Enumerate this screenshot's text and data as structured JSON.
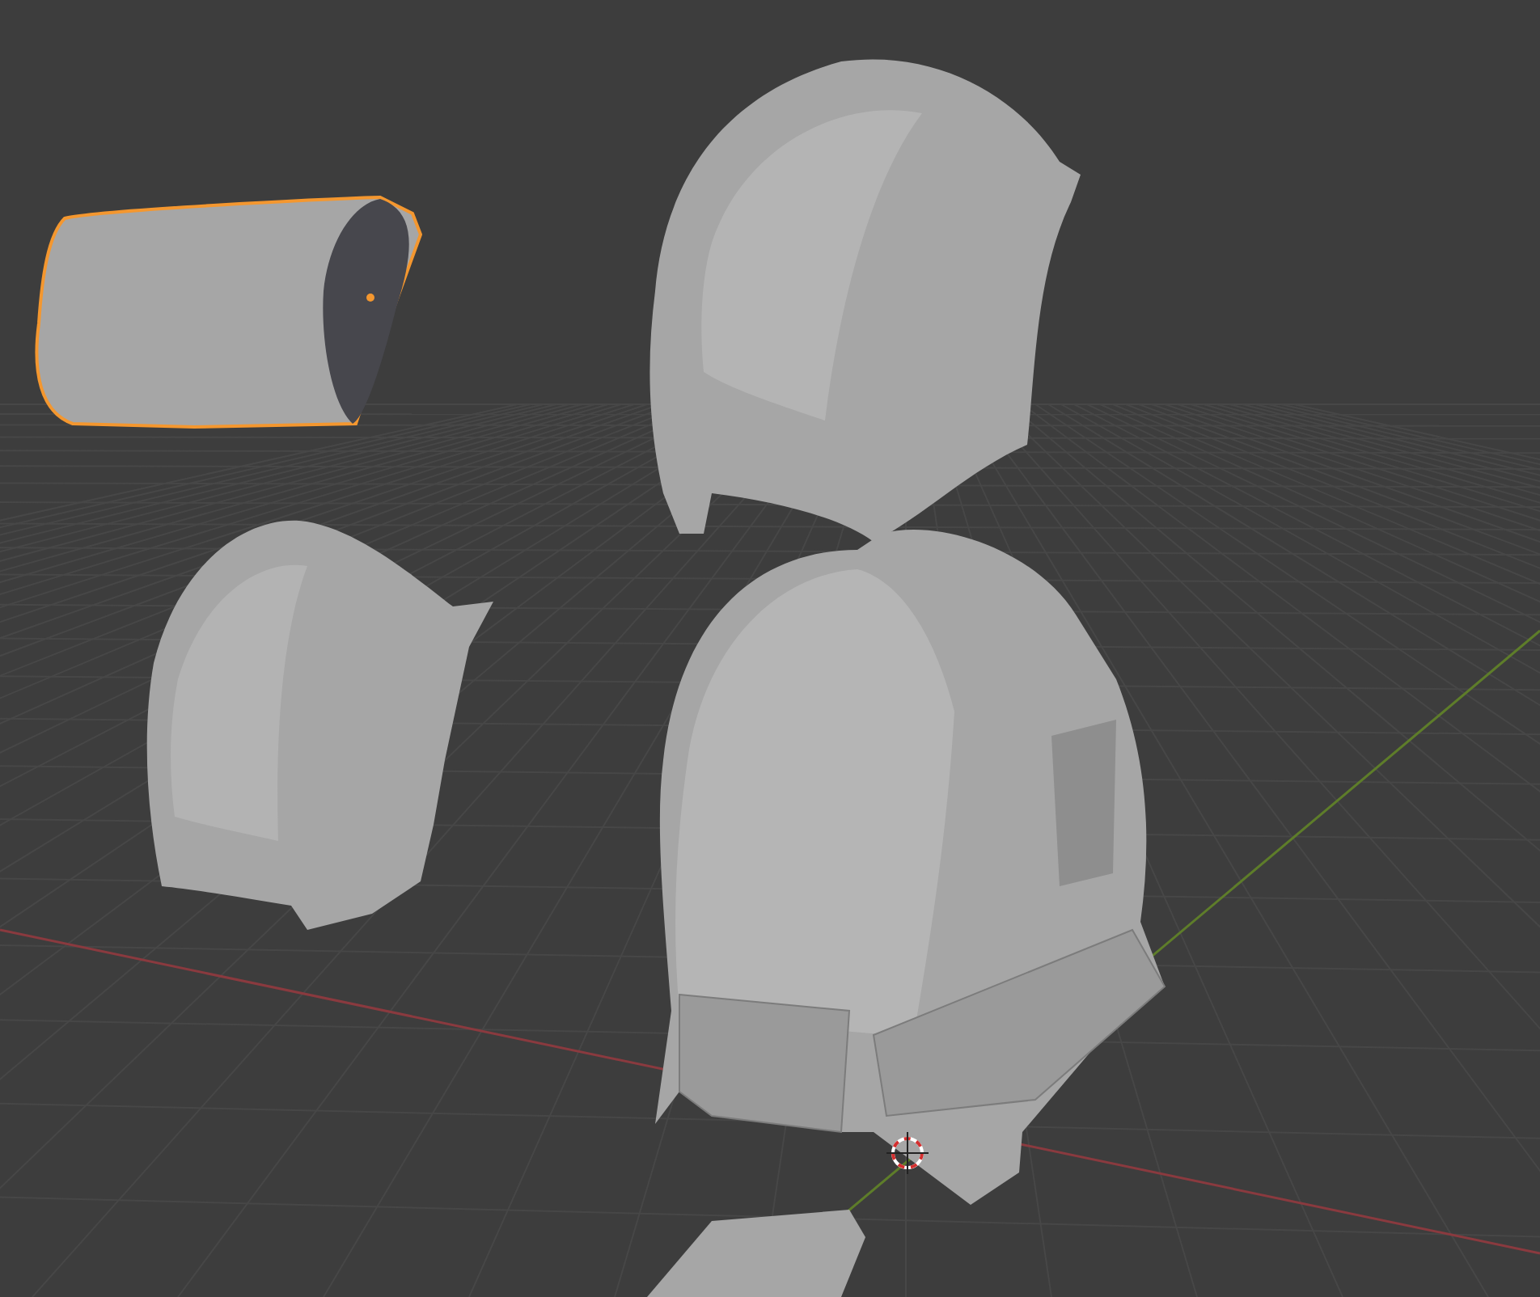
{
  "viewport": {
    "objects": [
      {
        "kind": "cylinder",
        "selected": true
      },
      {
        "kind": "top-shell",
        "selected": false
      },
      {
        "kind": "side-shell",
        "selected": false
      },
      {
        "kind": "helmet",
        "selected": false
      },
      {
        "kind": "plate",
        "selected": false
      }
    ]
  }
}
